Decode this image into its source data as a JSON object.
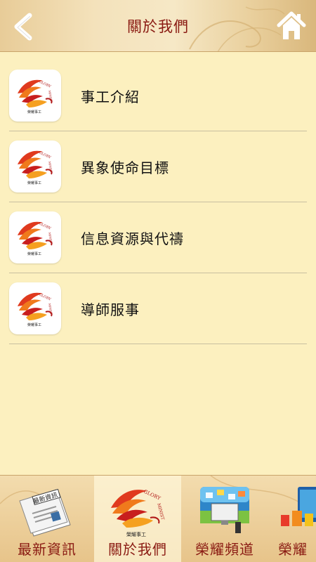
{
  "header": {
    "title": "關於我們",
    "back_icon": "chevron-left-icon",
    "home_icon": "home-icon"
  },
  "logo": {
    "brand_text": "GLORY MINISTRIES",
    "brand_cn": "榮耀事工"
  },
  "list": {
    "items": [
      {
        "label": "事工介紹"
      },
      {
        "label": "異象使命目標"
      },
      {
        "label": "信息資源與代禱"
      },
      {
        "label": "導師服事"
      }
    ]
  },
  "tabbar": {
    "tabs": [
      {
        "label": "最新資訊",
        "icon": "newspaper-icon",
        "active": false
      },
      {
        "label": "關於我們",
        "icon": "logo-icon",
        "active": true
      },
      {
        "label": "榮耀頻道",
        "icon": "media-channel-icon",
        "active": false
      },
      {
        "label": "榮耀",
        "icon": "shop-icon",
        "active": false
      }
    ],
    "newspaper_text": "最新資訊"
  },
  "colors": {
    "accent": "#8a1a12",
    "background": "#fcf0bf",
    "header": "#f4e2bb"
  }
}
